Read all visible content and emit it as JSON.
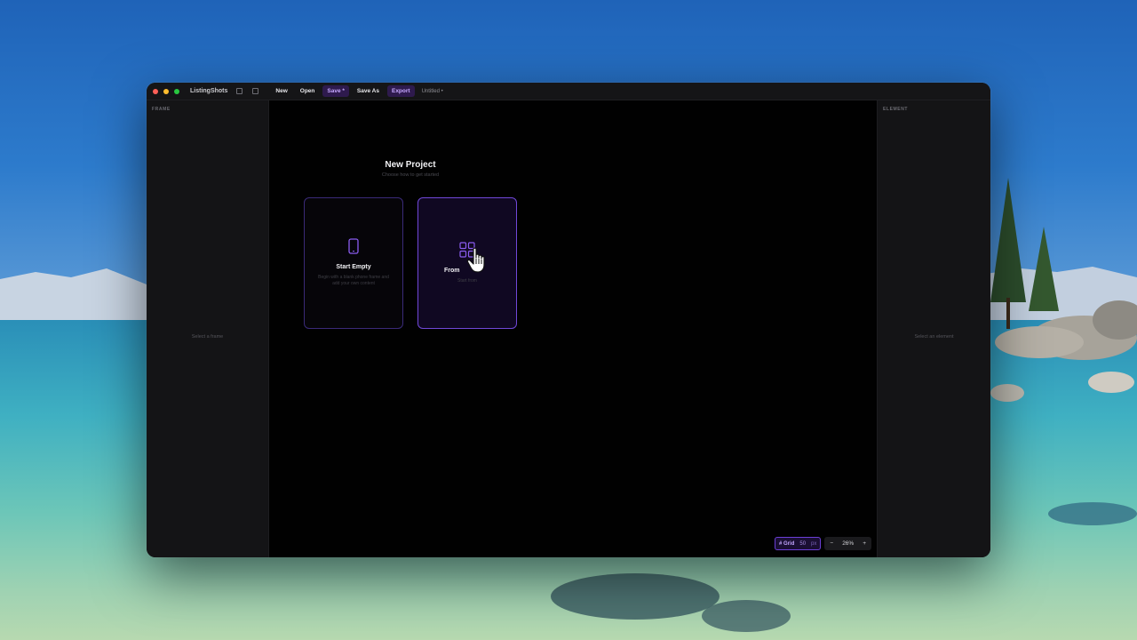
{
  "app": {
    "name": "ListingShots",
    "document_name": "Untitled •"
  },
  "menu": {
    "new": "New",
    "open": "Open",
    "save": "Save *",
    "save_as": "Save As",
    "export": "Export"
  },
  "left_panel": {
    "heading": "FRAME",
    "empty_text": "Select a frame"
  },
  "right_panel": {
    "heading": "ELEMENT",
    "empty_text": "Select an element"
  },
  "new_project": {
    "title": "New Project",
    "subtitle": "Choose how to get started",
    "cards": [
      {
        "title": "Start Empty",
        "description": "Begin with a blank phone frame and add your own content",
        "icon": "phone-icon"
      },
      {
        "title": "From",
        "description": "Start from",
        "icon": "grid-icon"
      }
    ]
  },
  "bottom_bar": {
    "grid_label": "# Grid",
    "grid_value": "50",
    "grid_unit": "px",
    "zoom_out": "−",
    "zoom_value": "26%",
    "zoom_in": "+"
  },
  "colors": {
    "accent": "#7048d8",
    "window_bg": "#0b0b0d",
    "panel_bg": "#141416"
  }
}
